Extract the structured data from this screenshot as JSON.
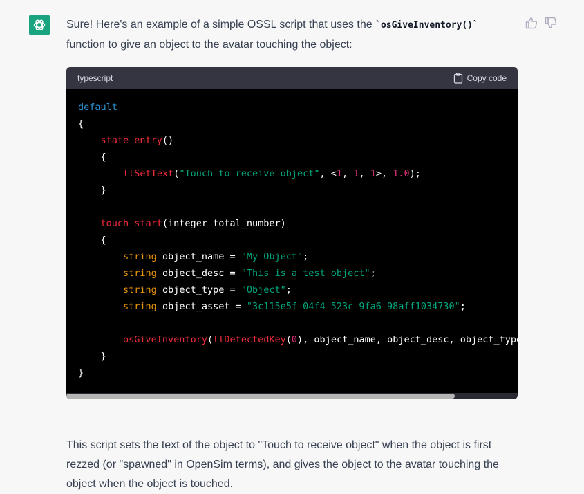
{
  "message": {
    "intro_before": "Sure! Here's an example of a simple OSSL script that uses the ",
    "intro_code": "`osGiveInventory()`",
    "intro_after": " function to give an object to the avatar touching the object:",
    "outro": "This script sets the text of the object to \"Touch to receive object\" when the object is first rezzed (or \"spawned\" in OpenSim terms), and gives the object to the avatar touching the object when the object is touched."
  },
  "codeblock": {
    "language": "typescript",
    "copy_label": "Copy code",
    "lines": [
      [
        {
          "t": "default",
          "c": "kw"
        }
      ],
      [
        {
          "t": "{"
        }
      ],
      [
        {
          "t": "    "
        },
        {
          "t": "state_entry",
          "c": "fn"
        },
        {
          "t": "()"
        }
      ],
      [
        {
          "t": "    {"
        }
      ],
      [
        {
          "t": "        "
        },
        {
          "t": "llSetText",
          "c": "fn"
        },
        {
          "t": "("
        },
        {
          "t": "\"Touch to receive object\"",
          "c": "str"
        },
        {
          "t": ", <"
        },
        {
          "t": "1",
          "c": "num"
        },
        {
          "t": ", "
        },
        {
          "t": "1",
          "c": "num"
        },
        {
          "t": ", "
        },
        {
          "t": "1",
          "c": "num"
        },
        {
          "t": ">, "
        },
        {
          "t": "1.0",
          "c": "num"
        },
        {
          "t": ");"
        }
      ],
      [
        {
          "t": "    }"
        }
      ],
      [
        {
          "t": ""
        }
      ],
      [
        {
          "t": "    "
        },
        {
          "t": "touch_start",
          "c": "fn"
        },
        {
          "t": "(integer total_number)"
        }
      ],
      [
        {
          "t": "    {"
        }
      ],
      [
        {
          "t": "        "
        },
        {
          "t": "string",
          "c": "ty"
        },
        {
          "t": " object_name = "
        },
        {
          "t": "\"My Object\"",
          "c": "str"
        },
        {
          "t": ";"
        }
      ],
      [
        {
          "t": "        "
        },
        {
          "t": "string",
          "c": "ty"
        },
        {
          "t": " object_desc = "
        },
        {
          "t": "\"This is a test object\"",
          "c": "str"
        },
        {
          "t": ";"
        }
      ],
      [
        {
          "t": "        "
        },
        {
          "t": "string",
          "c": "ty"
        },
        {
          "t": " object_type = "
        },
        {
          "t": "\"Object\"",
          "c": "str"
        },
        {
          "t": ";"
        }
      ],
      [
        {
          "t": "        "
        },
        {
          "t": "string",
          "c": "ty"
        },
        {
          "t": " object_asset = "
        },
        {
          "t": "\"3c115e5f-04f4-523c-9fa6-98aff1034730\"",
          "c": "str"
        },
        {
          "t": ";"
        }
      ],
      [
        {
          "t": ""
        }
      ],
      [
        {
          "t": "        "
        },
        {
          "t": "osGiveInventory",
          "c": "fn"
        },
        {
          "t": "("
        },
        {
          "t": "llDetectedKey",
          "c": "fn"
        },
        {
          "t": "("
        },
        {
          "t": "0",
          "c": "num"
        },
        {
          "t": "), object_name, object_desc, object_type, ob"
        }
      ],
      [
        {
          "t": "    }"
        }
      ],
      [
        {
          "t": "}"
        }
      ]
    ]
  },
  "icons": {
    "avatar": "openai-logo-icon",
    "copy": "clipboard-icon",
    "like": "thumbs-up-icon",
    "dislike": "thumbs-down-icon"
  },
  "colors": {
    "avatar_bg": "#19a37f",
    "code_bg": "#000000",
    "code_header_bg": "#343541",
    "keyword": "#2e95d3",
    "function": "#f22c3d",
    "string": "#00a67d",
    "number": "#df3079",
    "type": "#e9950c"
  },
  "scroll": {
    "horizontal_thumb_fraction": 0.86
  }
}
